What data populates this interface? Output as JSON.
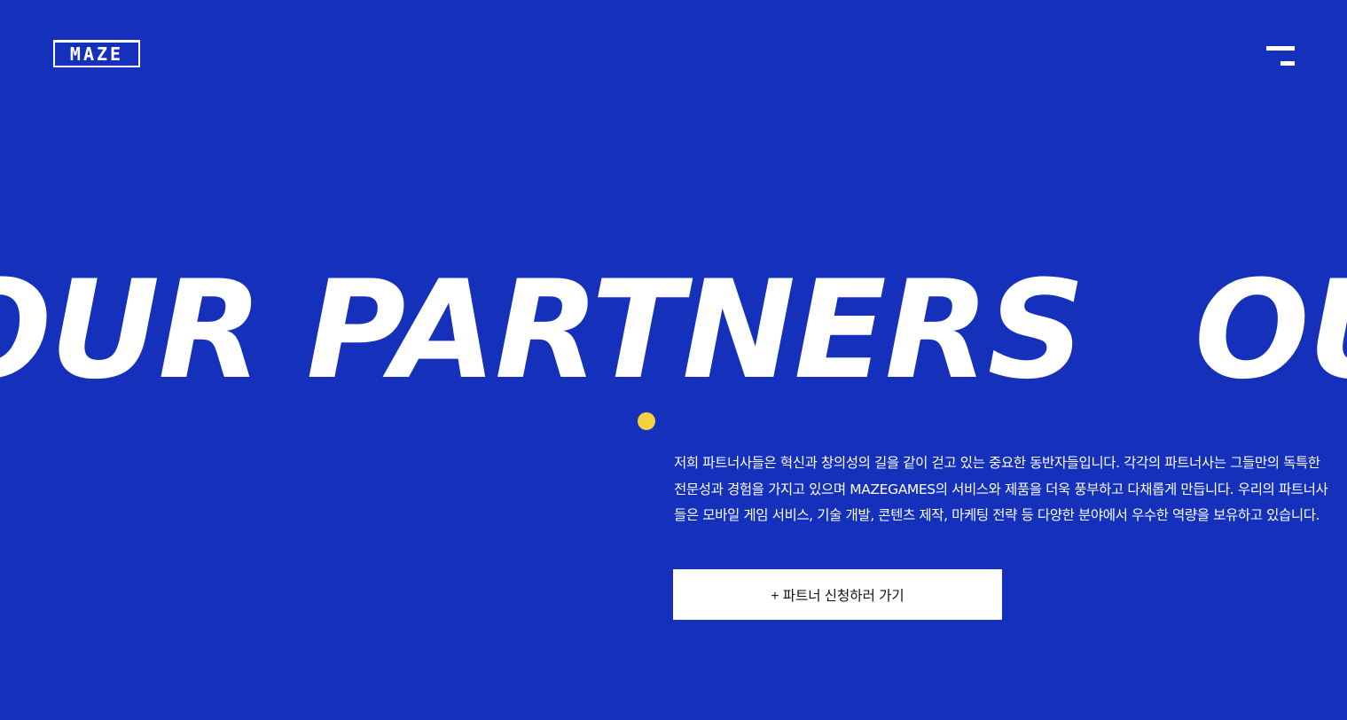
{
  "header": {
    "logo_text": "MAZE",
    "menu_icon": "hamburger-menu-icon"
  },
  "hero": {
    "marquee": [
      "OUR PARTNERS",
      "OUR PARTNERS"
    ],
    "accent_color": "#f2d33e",
    "background_color": "#1531bb"
  },
  "content": {
    "description": "저희 파트너사들은 혁신과 창의성의 길을 같이 걷고 있는 중요한 동반자들입니다. 각각의 파트너사는 그들만의 독특한 전문성과 경험을 가지고 있으며 MAZEGAMES의 서비스와 제품을 더욱 풍부하고 다채롭게 만듭니다. 우리의 파트너사들은 모바일 게임 서비스, 기술 개발, 콘텐츠 제작, 마케팅 전략 등 다양한 분야에서 우수한 역량을 보유하고 있습니다.",
    "cta_label": "+ 파트너 신청하러 가기"
  }
}
